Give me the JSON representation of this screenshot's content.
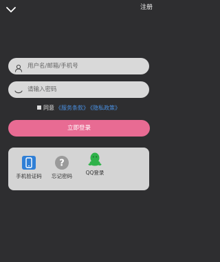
{
  "topbar": {
    "back_icon": "chevron-down-icon",
    "register_label": "注册"
  },
  "login_form": {
    "username_placeholder": "用户名/邮箱/手机号",
    "username_value": "",
    "password_placeholder": "请输入密码",
    "password_value": ""
  },
  "agreement": {
    "agree_label": "同意",
    "terms_link": "《服务条款》",
    "privacy_link": "《隐私政策》"
  },
  "login_button_label": "立即登录",
  "alt_login": {
    "items": [
      {
        "label": "手机验证码",
        "icon": "phone-icon"
      },
      {
        "label": "忘记密码",
        "icon": "question-icon"
      },
      {
        "label": "QQ登录",
        "icon": "qq-icon"
      }
    ]
  },
  "colors": {
    "background": "#2e2e30",
    "field": "#d9d9d9",
    "accent_button": "#e86b93",
    "link": "#4a90e2",
    "phone_icon": "#2f7fd6",
    "qq_icon": "#2fb24a"
  }
}
